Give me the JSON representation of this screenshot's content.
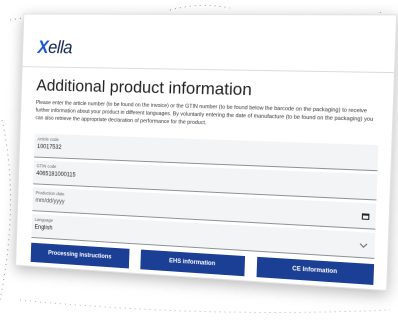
{
  "brand": {
    "name": "ella",
    "mark": "X"
  },
  "page": {
    "title": "Additional product information",
    "description": "Please enter the article number (to be found on the invoice) or the GTIN number (to be found below the barcode on the packaging) to receive further information about your product in different languages. By voluntarily entering the date of manufacture (to be found on the packaging) you can also retrieve the appropriate declaration of performance for the product."
  },
  "form": {
    "article_code": {
      "label": "Article code",
      "value": "10017532"
    },
    "gtin_code": {
      "label": "GTIN code",
      "value": "4065181000115"
    },
    "production_date": {
      "label": "Production date",
      "placeholder": "mm/dd/yyyy"
    },
    "language": {
      "label": "Language",
      "value": "English"
    }
  },
  "buttons": {
    "processing": "Processing instructions",
    "ehs": "EHS information",
    "ce": "CE Information"
  },
  "colors": {
    "button_bg": "#1c3f96",
    "logo_accent": "#1b56c8",
    "field_bg": "#f3f4f6"
  }
}
